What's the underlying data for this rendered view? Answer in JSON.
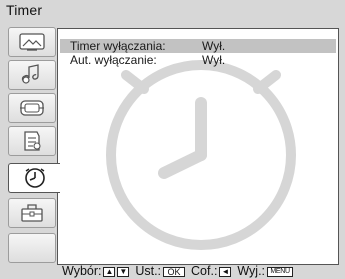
{
  "window": {
    "title": "Timer"
  },
  "sidebar": {
    "items": [
      {
        "icon": "picture-icon"
      },
      {
        "icon": "sound-icon"
      },
      {
        "icon": "screen-icon"
      },
      {
        "icon": "features-icon"
      },
      {
        "icon": "timer-clock-icon",
        "active": true
      },
      {
        "icon": "setup-toolbox-icon"
      },
      {
        "icon": "empty-slot"
      }
    ]
  },
  "menu": {
    "rows": [
      {
        "label": "Timer wyłączania:",
        "value": "Wył.",
        "selected": true
      },
      {
        "label": "Aut. wyłączanie:",
        "value": "Wył.",
        "selected": false
      }
    ]
  },
  "footer": {
    "select_label": "Wybór:",
    "select_keys": [
      "▲",
      "▼"
    ],
    "set_label": "Ust.:",
    "set_key": "OK",
    "back_label": "Cof.:",
    "back_key": "◄",
    "exit_label": "Wyj.:",
    "exit_key": "MENU"
  },
  "colors": {
    "osd_background": "#d7d7d7",
    "content_background": "#ffffff",
    "selection": "#c2c2c2",
    "watermark": "#d6d6d6"
  }
}
